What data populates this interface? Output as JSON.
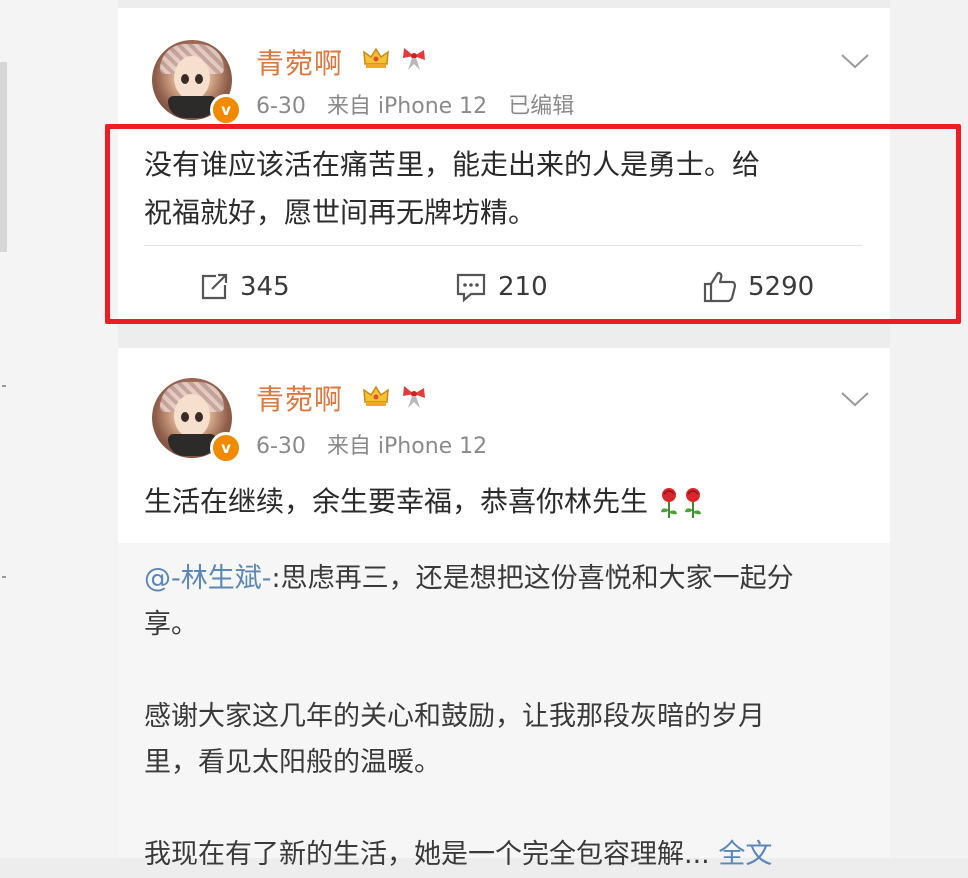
{
  "posts": [
    {
      "username": "青菀啊",
      "date": "6-30",
      "source": "来自 iPhone 12",
      "edited": "已编辑",
      "content_lines": [
        "没有谁应该活在痛苦里，能走出来的人是勇士。给",
        "祝福就好，愿世间再无牌坊精。"
      ],
      "actions": {
        "repost_count": "345",
        "comment_count": "210",
        "like_count": "5290"
      }
    },
    {
      "username": "青菀啊",
      "date": "6-30",
      "source": "来自 iPhone 12",
      "content": "生活在继续，余生要幸福，恭喜你林先生",
      "quote": {
        "mention": "@-林生斌-",
        "line1_rest": ":思虑再三，还是想把这份喜悦和大家一起分",
        "line2": "享。",
        "para2_line1": "感谢大家这几年的关心和鼓励，让我那段灰暗的岁月",
        "para2_line2": "里，看见太阳般的温暖。",
        "para3": "我现在有了新的生活，她是一个完全包容理解...",
        "full_text_link": "全文"
      }
    }
  ],
  "colors": {
    "username": "#e0763a",
    "highlight_border": "#ee1c25",
    "link": "#5a87b8",
    "verified_badge": "#f08a00"
  },
  "icons": [
    "crown-icon",
    "bow-icon",
    "chevron-down-icon",
    "repost-icon",
    "comment-icon",
    "like-icon",
    "rose-icon",
    "verified-badge-icon"
  ]
}
